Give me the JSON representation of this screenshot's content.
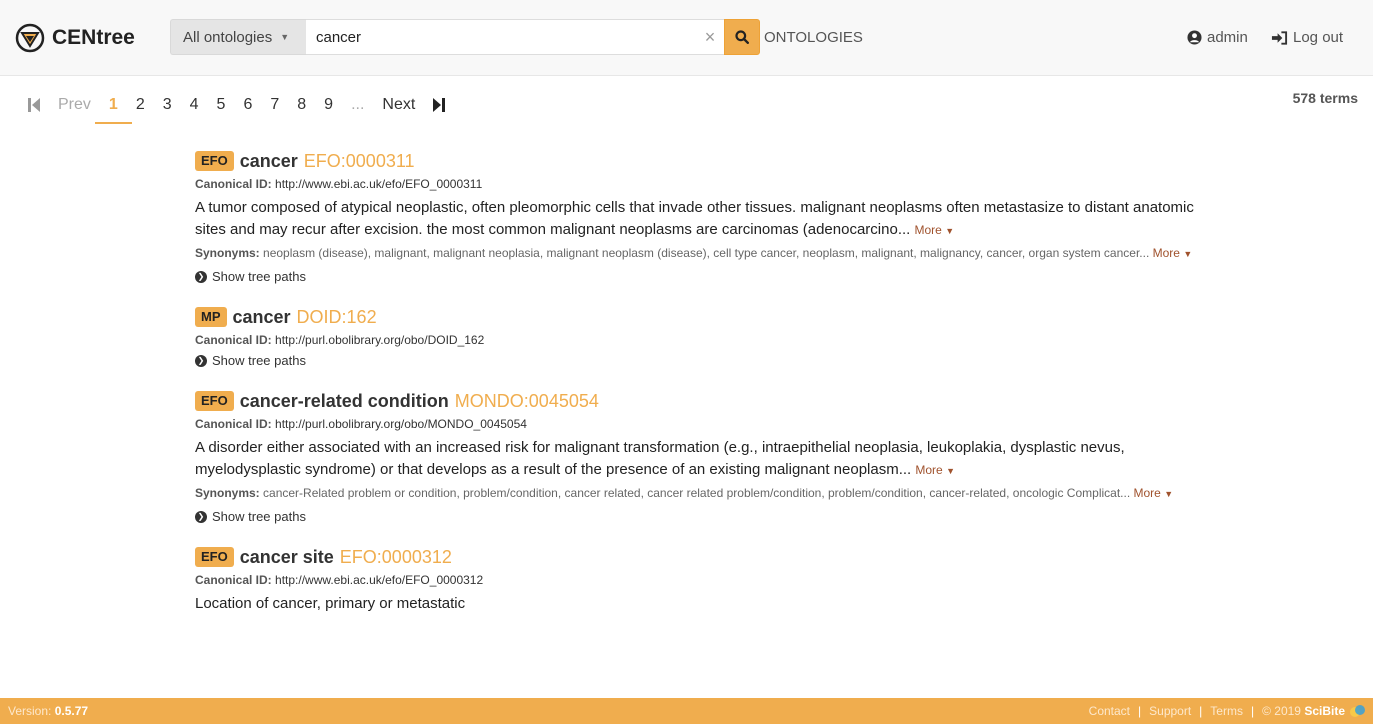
{
  "brand": {
    "name": "CENtree"
  },
  "search": {
    "ontology_select": "All ontologies",
    "query": "cancer",
    "clear_label": "×"
  },
  "nav": {
    "ontologies": "ONTOLOGIES",
    "user": "admin",
    "logout": "Log out"
  },
  "pagination": {
    "prev": "Prev",
    "next": "Next",
    "pages": [
      "1",
      "2",
      "3",
      "4",
      "5",
      "6",
      "7",
      "8",
      "9"
    ],
    "ellipsis": "...",
    "current": "1",
    "total": "578 terms"
  },
  "labels": {
    "canonical": "Canonical ID:",
    "synonyms": "Synonyms:",
    "more": "More",
    "show_tree": "Show tree paths"
  },
  "results": [
    {
      "badge": "EFO",
      "label": "cancer",
      "id": "EFO:0000311",
      "canonical": "http://www.ebi.ac.uk/efo/EFO_0000311",
      "description": "A tumor composed of atypical neoplastic, often pleomorphic cells that invade other tissues. malignant neoplasms often metastasize to distant anatomic sites and may recur after excision. the most common malignant neoplasms are carcinomas (adenocarcino...",
      "synonyms": "neoplasm (disease), malignant, malignant neoplasia, malignant neoplasm (disease), cell type cancer, neoplasm, malignant, malignancy, cancer, organ system cancer..."
    },
    {
      "badge": "MP",
      "label": "cancer",
      "id": "DOID:162",
      "canonical": "http://purl.obolibrary.org/obo/DOID_162"
    },
    {
      "badge": "EFO",
      "label": "cancer-related condition",
      "id": "MONDO:0045054",
      "canonical": "http://purl.obolibrary.org/obo/MONDO_0045054",
      "description": "A disorder either associated with an increased risk for malignant transformation (e.g., intraepithelial neoplasia, leukoplakia, dysplastic nevus, myelodysplastic syndrome) or that develops as a result of the presence of an existing malignant neoplasm...",
      "synonyms": "cancer-Related problem or condition, problem/condition, cancer related, cancer related problem/condition, problem/condition, cancer-related, oncologic Complicat..."
    },
    {
      "badge": "EFO",
      "label": "cancer site",
      "id": "EFO:0000312",
      "canonical": "http://www.ebi.ac.uk/efo/EFO_0000312",
      "description": "Location of cancer, primary or metastatic"
    }
  ],
  "footer": {
    "version_label": "Version:",
    "version": "0.5.77",
    "contact": "Contact",
    "support": "Support",
    "terms": "Terms",
    "copyright": "© 2019",
    "company": "SciBite"
  },
  "colors": {
    "accent": "#f0ad4e",
    "link": "#a0522d"
  }
}
